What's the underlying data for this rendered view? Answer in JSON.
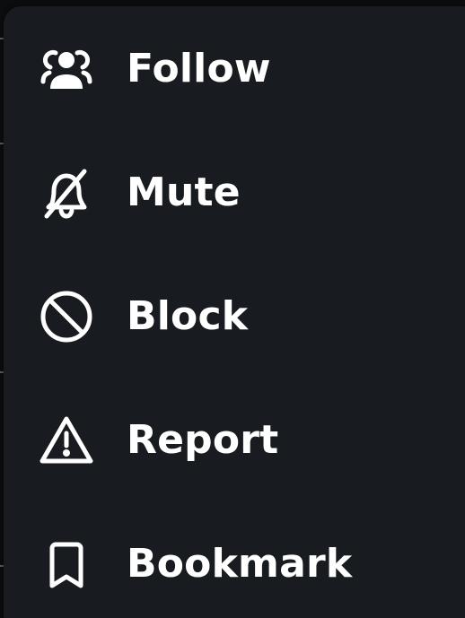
{
  "menu": {
    "items": [
      {
        "label": "Follow",
        "icon": "users-icon"
      },
      {
        "label": "Mute",
        "icon": "bell-off-icon"
      },
      {
        "label": "Block",
        "icon": "block-icon"
      },
      {
        "label": "Report",
        "icon": "warning-icon"
      },
      {
        "label": "Bookmark",
        "icon": "bookmark-icon"
      }
    ]
  },
  "colors": {
    "menu_background": "#181b1f",
    "text": "#ffffff",
    "page_background": "#0c0d0f"
  }
}
